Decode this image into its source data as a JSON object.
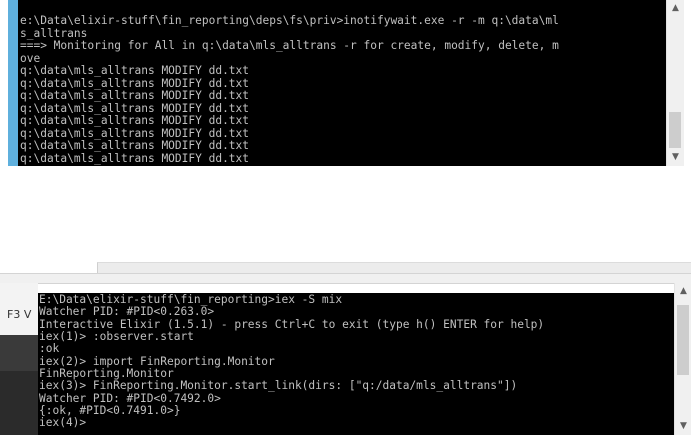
{
  "top_console": {
    "lines": [
      "e:\\Data\\elixir-stuff\\fin_reporting\\deps\\fs\\priv>inotifywait.exe -r -m q:\\data\\ml",
      "s_alltrans",
      "===> Monitoring for All in q:\\data\\mls_alltrans -r for create, modify, delete, m",
      "ove",
      "q:\\data\\mls_alltrans MODIFY dd.txt",
      "q:\\data\\mls_alltrans MODIFY dd.txt",
      "q:\\data\\mls_alltrans MODIFY dd.txt",
      "q:\\data\\mls_alltrans MODIFY dd.txt",
      "q:\\data\\mls_alltrans MODIFY dd.txt",
      "q:\\data\\mls_alltrans MODIFY dd.txt",
      "q:\\data\\mls_alltrans MODIFY dd.txt",
      "q:\\data\\mls_alltrans MODIFY dd.txt"
    ],
    "scrollbar_icons": {
      "up": "chevron-up-icon",
      "down": "chevron-down-icon"
    }
  },
  "left_pane": {
    "label": "F3 V"
  },
  "bottom_console": {
    "lines": [
      "E:\\Data\\elixir-stuff\\fin_reporting>iex -S mix",
      "Watcher PID: #PID<0.263.0>",
      "Interactive Elixir (1.5.1) - press Ctrl+C to exit (type h() ENTER for help)",
      "iex(1)> :observer.start",
      ":ok",
      "iex(2)> import FinReporting.Monitor",
      "FinReporting.Monitor",
      "iex(3)> FinReporting.Monitor.start_link(dirs: [\"q:/data/mls_alltrans\"])",
      "Watcher PID: #PID<0.7492.0>",
      "{:ok, #PID<0.7491.0>}",
      "iex(4)>"
    ]
  },
  "colors": {
    "console_bg": "#000000",
    "console_text": "#c0c0c0",
    "accent_bar": "#5fb0dd",
    "scrollbar_bg": "#f0f0f0"
  }
}
